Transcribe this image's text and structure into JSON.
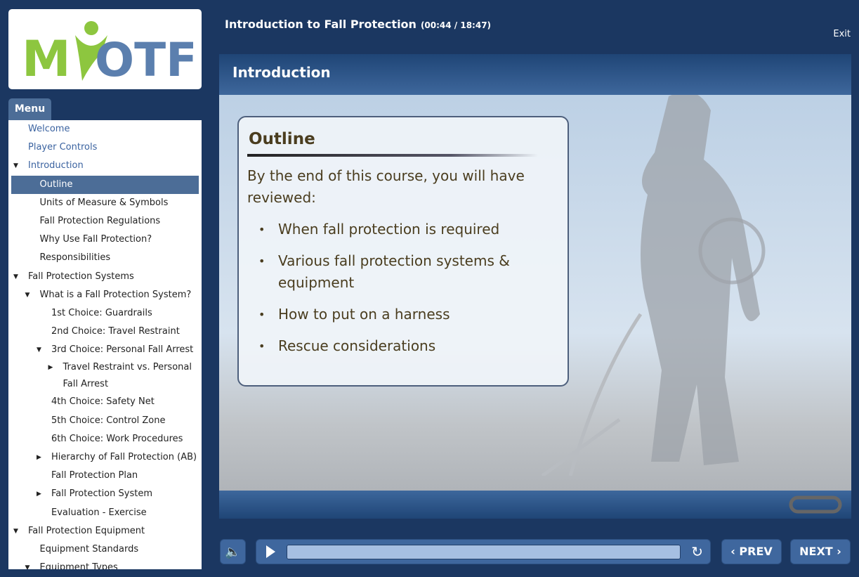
{
  "logo": {
    "text": "MYOTF",
    "colors": {
      "green": "#8dc63f",
      "blue": "#5b7fae"
    }
  },
  "header": {
    "title": "Introduction to Fall Protection",
    "time": "(00:44 / 18:47)",
    "exit_label": "Exit"
  },
  "menu": {
    "tab_label": "Menu",
    "items": [
      {
        "label": "Welcome",
        "level": 0,
        "toggle": "none",
        "style": "blue"
      },
      {
        "label": "Player Controls",
        "level": 0,
        "toggle": "none",
        "style": "blue"
      },
      {
        "label": "Introduction",
        "level": 0,
        "toggle": "expanded",
        "style": "blue"
      },
      {
        "label": "Outline",
        "level": 1,
        "toggle": "none",
        "style": "selected"
      },
      {
        "label": "Units of Measure & Symbols",
        "level": 1,
        "toggle": "none"
      },
      {
        "label": "Fall Protection Regulations",
        "level": 1,
        "toggle": "none"
      },
      {
        "label": "Why Use Fall Protection?",
        "level": 1,
        "toggle": "none"
      },
      {
        "label": "Responsibilities",
        "level": 1,
        "toggle": "none"
      },
      {
        "label": "Fall Protection Systems",
        "level": 0,
        "toggle": "expanded"
      },
      {
        "label": "What is a Fall Protection System?",
        "level": 1,
        "toggle": "expanded"
      },
      {
        "label": "1st Choice: Guardrails",
        "level": 2,
        "toggle": "none"
      },
      {
        "label": "2nd Choice: Travel Restraint",
        "level": 2,
        "toggle": "none"
      },
      {
        "label": "3rd Choice: Personal Fall Arrest",
        "level": 2,
        "toggle": "expanded"
      },
      {
        "label": "Travel Restraint vs. Personal Fall Arrest",
        "level": 3,
        "toggle": "collapsed"
      },
      {
        "label": "4th Choice: Safety Net",
        "level": 2,
        "toggle": "none"
      },
      {
        "label": "5th Choice: Control Zone",
        "level": 2,
        "toggle": "none"
      },
      {
        "label": "6th Choice: Work Procedures",
        "level": 2,
        "toggle": "none"
      },
      {
        "label": "Hierarchy of Fall Protection (AB)",
        "level": 2,
        "toggle": "collapsed"
      },
      {
        "label": "Fall Protection Plan",
        "level": 2,
        "toggle": "none"
      },
      {
        "label": "Fall Protection System",
        "level": 2,
        "toggle": "collapsed"
      },
      {
        "label": "Evaluation - Exercise",
        "level": 2,
        "toggle": "none"
      },
      {
        "label": "Fall Protection Equipment",
        "level": 0,
        "toggle": "expanded"
      },
      {
        "label": "Equipment Standards",
        "level": 1,
        "toggle": "none"
      },
      {
        "label": "Equipment Types",
        "level": 1,
        "toggle": "expanded"
      }
    ]
  },
  "slide": {
    "section_title": "Introduction",
    "card_title": "Outline",
    "intro": "By the end of this course, you will have reviewed:",
    "bullets": [
      "When fall protection is required",
      "Various fall protection systems & equipment",
      "How to put on a harness",
      "Rescue considerations"
    ]
  },
  "controls": {
    "volume_icon": "speaker-icon",
    "play_icon": "play-icon",
    "replay_icon": "replay-icon",
    "progress_percent": 100,
    "prev_label": "PREV",
    "next_label": "NEXT"
  }
}
